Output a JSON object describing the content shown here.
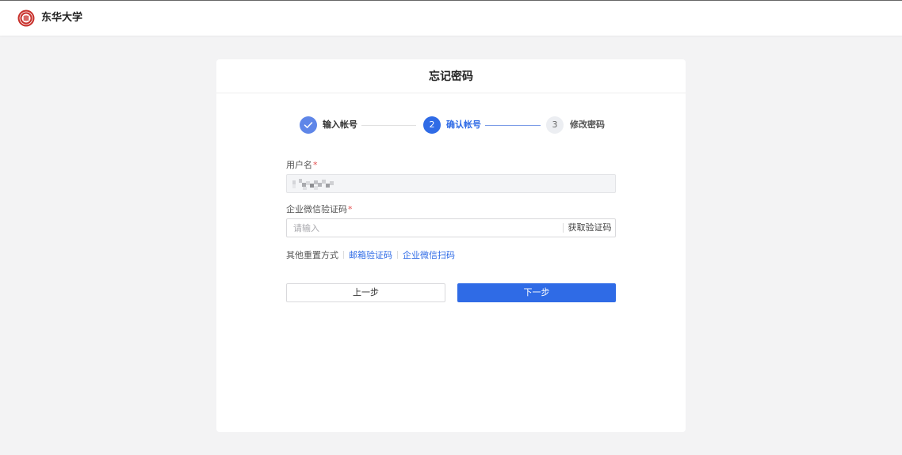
{
  "header": {
    "brand_name": "东华大学",
    "logo_icon": "university-seal-icon"
  },
  "card": {
    "title": "忘记密码"
  },
  "steps": [
    {
      "number": "",
      "label": "输入帐号",
      "state": "completed",
      "icon": "check-icon"
    },
    {
      "number": "2",
      "label": "确认帐号",
      "state": "active"
    },
    {
      "number": "3",
      "label": "修改密码",
      "state": "pending"
    }
  ],
  "form": {
    "username": {
      "label": "用户名",
      "required_mark": "*",
      "disabled": true
    },
    "wechat_code": {
      "label": "企业微信验证码",
      "required_mark": "*",
      "placeholder": "请输入",
      "value": "",
      "get_code_label": "获取验证码"
    }
  },
  "other_methods": {
    "label": "其他重置方式",
    "links": [
      "邮箱验证码",
      "企业微信扫码"
    ]
  },
  "buttons": {
    "prev_label": "上一步",
    "next_label": "下一步"
  },
  "colors": {
    "primary": "#2f6be6",
    "completed_step": "#5f86e8",
    "page_background": "#f3f3f4",
    "logo_red": "#c8302b",
    "required": "#e34d4d"
  }
}
